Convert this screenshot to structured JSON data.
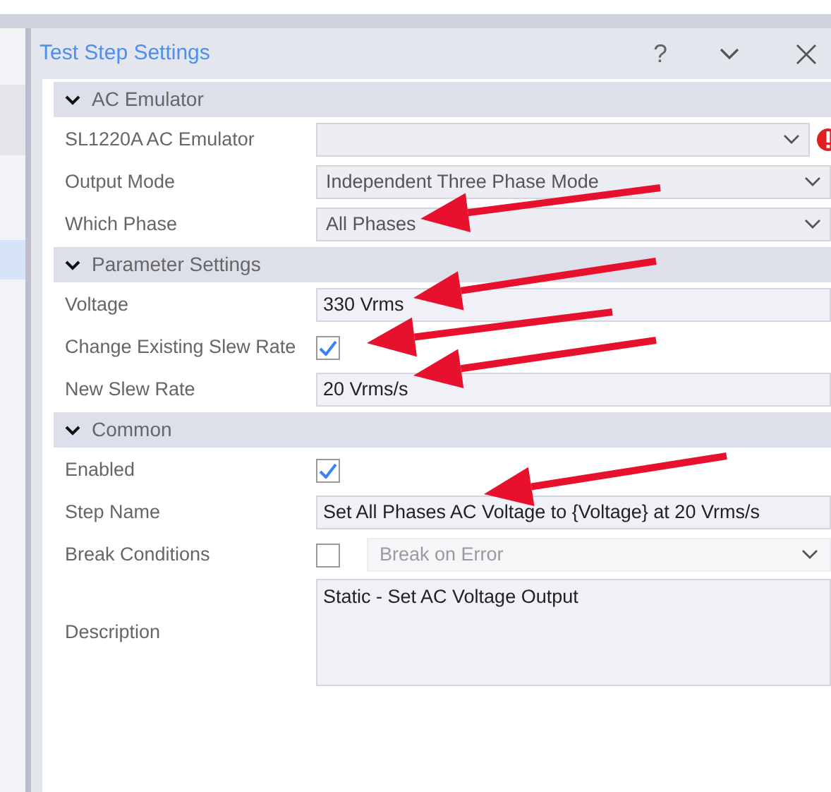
{
  "panel": {
    "title": "Test Step Settings",
    "buttons": [
      "?"
    ]
  },
  "sections": [
    {
      "title": "AC Emulator",
      "expanded": true,
      "fields": [
        {
          "kind": "dropdown",
          "label": "SL1220A AC Emulator",
          "error": true
        },
        {
          "kind": "dropdown",
          "label": "Output Mode",
          "value": "Independent Three Phase Mode"
        },
        {
          "kind": "dropdown",
          "label": "Which Phase",
          "value": "All Phases"
        }
      ]
    },
    {
      "title": "Parameter Settings",
      "expanded": true,
      "fields": [
        {
          "kind": "text",
          "label": "Voltage",
          "value": "330 Vrms"
        },
        {
          "kind": "checkbox",
          "label": "Change Existing Slew Rate",
          "checked": true
        },
        {
          "kind": "text",
          "label": "New Slew Rate",
          "value": "20 Vrms/s"
        }
      ]
    },
    {
      "title": "Common",
      "expanded": true,
      "fields": [
        {
          "kind": "checkbox",
          "label": "Enabled",
          "checked": true
        },
        {
          "kind": "text",
          "label": "Step Name",
          "value": "Set All Phases AC Voltage to {Voltage} at 20 Vrms/s"
        },
        {
          "kind": "checkbox_dropdown",
          "label": "Break Conditions",
          "checked": false,
          "value": "Break on Error",
          "disabled": true
        },
        {
          "kind": "textarea",
          "label": "Description",
          "value": "Static - Set AC Voltage Output"
        }
      ]
    }
  ]
}
